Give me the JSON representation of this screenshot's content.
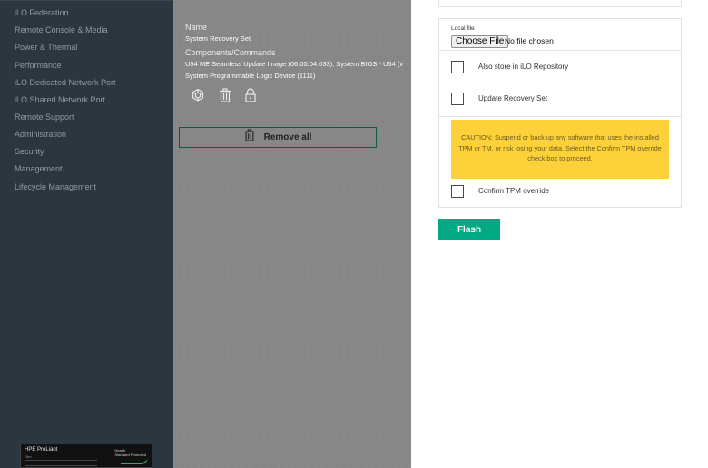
{
  "sidebar": {
    "items": [
      {
        "label": "iLO Federation"
      },
      {
        "label": "Remote Console & Media"
      },
      {
        "label": "Power & Thermal"
      },
      {
        "label": "Performance"
      },
      {
        "label": "iLO Dedicated Network Port"
      },
      {
        "label": "iLO Shared Network Port"
      },
      {
        "label": "Remote Support"
      },
      {
        "label": "Administration"
      },
      {
        "label": "Security"
      },
      {
        "label": "Management"
      },
      {
        "label": "Lifecycle Management"
      }
    ],
    "server_thumbnail": {
      "title": "HPE ProLiant",
      "subtitle": "Gen",
      "side_text_1": "Health",
      "side_text_2": "Standard Protected"
    }
  },
  "install_set": {
    "name_label": "Name",
    "name_value": "System Recovery Set",
    "components_label": "Components/Commands",
    "components_line_1": "U54 ME Seamless Update Image (06.00.04.033); System BIOS - U54 (v",
    "components_line_2": "System Programmable Logic Device (1111)",
    "action_icons": [
      "deploy-icon",
      "trash-icon",
      "lock-icon"
    ],
    "remove_all_label": "Remove all",
    "remove_all_icon": "trash-icon"
  },
  "flash_panel": {
    "local_file_label": "Local file",
    "choose_file_label": "Choose File",
    "file_status": "No file chosen",
    "also_store_label": "Also store in iLO Repository",
    "update_recovery_label": "Update Recovery Set",
    "caution_text": "CAUTION: Suspend or back up any software that uses the installed TPM or TM, or risk losing your data. Select the Confirm TPM override check box to proceed.",
    "confirm_tpm_label": "Confirm TPM override",
    "flash_button_label": "Flash"
  },
  "colors": {
    "sidebar_bg": "#2b363f",
    "sidebar_text": "#8f9ba4",
    "overlay_bg": "#878787",
    "accent_green": "#01a982",
    "caution_yellow": "#fdd13a",
    "remove_border": "#0d5a46"
  }
}
